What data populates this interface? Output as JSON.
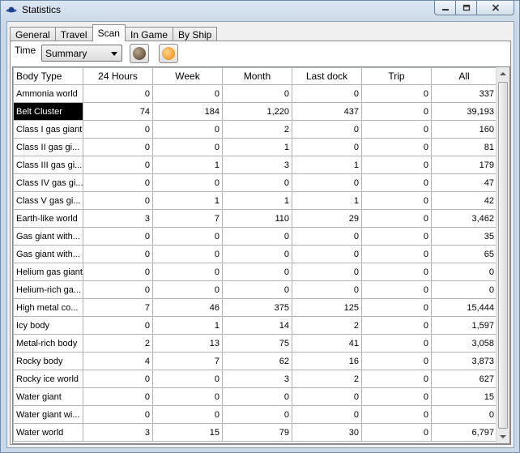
{
  "window": {
    "title": "Statistics"
  },
  "tabs": [
    "General",
    "Travel",
    "Scan",
    "In Game",
    "By Ship"
  ],
  "active_tab": "Scan",
  "toolbar": {
    "time_label": "Time",
    "time_selected": "Summary"
  },
  "table": {
    "columns": [
      "Body Type",
      "24 Hours",
      "Week",
      "Month",
      "Last dock",
      "Trip",
      "All"
    ],
    "rows": [
      [
        "Ammonia world",
        "0",
        "0",
        "0",
        "0",
        "0",
        "337"
      ],
      [
        "Belt Cluster",
        "74",
        "184",
        "1,220",
        "437",
        "0",
        "39,193"
      ],
      [
        "Class I gas giant",
        "0",
        "0",
        "2",
        "0",
        "0",
        "160"
      ],
      [
        "Class II gas gi...",
        "0",
        "0",
        "1",
        "0",
        "0",
        "81"
      ],
      [
        "Class III gas gi...",
        "0",
        "1",
        "3",
        "1",
        "0",
        "179"
      ],
      [
        "Class IV gas gi...",
        "0",
        "0",
        "0",
        "0",
        "0",
        "47"
      ],
      [
        "Class V gas gi...",
        "0",
        "1",
        "1",
        "1",
        "0",
        "42"
      ],
      [
        "Earth-like world",
        "3",
        "7",
        "110",
        "29",
        "0",
        "3,462"
      ],
      [
        "Gas giant with...",
        "0",
        "0",
        "0",
        "0",
        "0",
        "35"
      ],
      [
        "Gas giant with...",
        "0",
        "0",
        "0",
        "0",
        "0",
        "65"
      ],
      [
        "Helium gas giant",
        "0",
        "0",
        "0",
        "0",
        "0",
        "0"
      ],
      [
        "Helium-rich ga...",
        "0",
        "0",
        "0",
        "0",
        "0",
        "0"
      ],
      [
        "High metal co...",
        "7",
        "46",
        "375",
        "125",
        "0",
        "15,444"
      ],
      [
        "Icy body",
        "0",
        "1",
        "14",
        "2",
        "0",
        "1,597"
      ],
      [
        "Metal-rich body",
        "2",
        "13",
        "75",
        "41",
        "0",
        "3,058"
      ],
      [
        "Rocky body",
        "4",
        "7",
        "62",
        "16",
        "0",
        "3,873"
      ],
      [
        "Rocky ice world",
        "0",
        "0",
        "3",
        "2",
        "0",
        "627"
      ],
      [
        "Water giant",
        "0",
        "0",
        "0",
        "0",
        "0",
        "15"
      ],
      [
        "Water giant wi...",
        "0",
        "0",
        "0",
        "0",
        "0",
        "0"
      ],
      [
        "Water world",
        "3",
        "15",
        "79",
        "30",
        "0",
        "6,797"
      ]
    ],
    "selected_row": 1
  },
  "colors": {
    "selected_bg": "#000000",
    "selected_fg": "#ffffff",
    "grid_line": "#b4b4b4"
  }
}
